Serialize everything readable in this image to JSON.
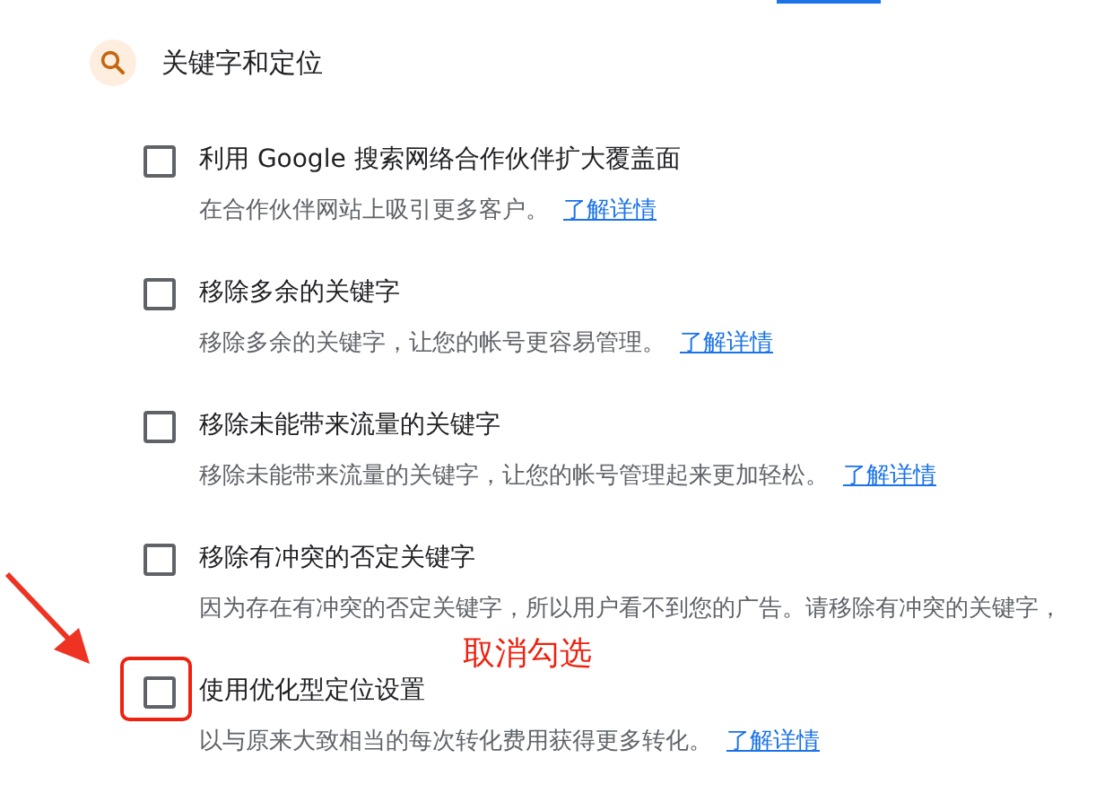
{
  "section": {
    "title": "关键字和定位"
  },
  "options": [
    {
      "title": "利用 Google 搜索网络合作伙伴扩大覆盖面",
      "checked": false,
      "description": "在合作伙伴网站上吸引更多客户。",
      "link": "了解详情"
    },
    {
      "title": "移除多余的关键字",
      "checked": false,
      "description": "移除多余的关键字，让您的帐号更容易管理。",
      "link": "了解详情"
    },
    {
      "title": "移除未能带来流量的关键字",
      "checked": false,
      "description": "移除未能带来流量的关键字，让您的帐号管理起来更加轻松。",
      "link": "了解详情"
    },
    {
      "title": "移除有冲突的否定关键字",
      "checked": false,
      "description": "因为存在有冲突的否定关键字，所以用户看不到您的广告。请移除有冲突的关键字，"
    },
    {
      "title": "使用优化型定位设置",
      "checked": false,
      "description": "以与原来大致相当的每次转化费用获得更多转化。",
      "link": "了解详情",
      "highlighted": true
    }
  ],
  "annotation": {
    "text": "取消勾选"
  }
}
